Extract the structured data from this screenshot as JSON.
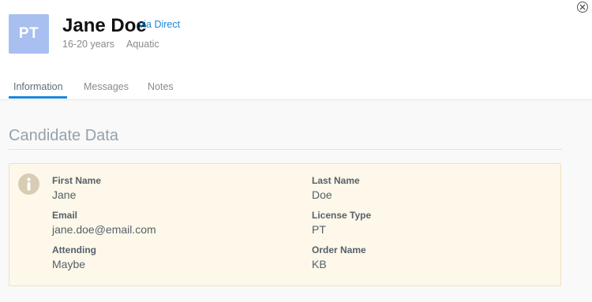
{
  "header": {
    "avatar_initials": "PT",
    "name": "Jane Doe",
    "via": "via Direct",
    "age_range": "16-20 years",
    "category": "Aquatic"
  },
  "tabs": [
    {
      "label": "Information",
      "active": true
    },
    {
      "label": "Messages",
      "active": false
    },
    {
      "label": "Notes",
      "active": false
    }
  ],
  "section": {
    "title": "Candidate Data",
    "fields": [
      {
        "label": "First Name",
        "value": "Jane"
      },
      {
        "label": "Last Name",
        "value": "Doe"
      },
      {
        "label": "Email",
        "value": "jane.doe@email.com"
      },
      {
        "label": "License Type",
        "value": "PT"
      },
      {
        "label": "Attending",
        "value": "Maybe"
      },
      {
        "label": "Order Name",
        "value": "KB"
      }
    ]
  },
  "icons": {
    "close": "close-circle-icon",
    "info": "info-icon"
  },
  "colors": {
    "accent": "#1f86d6",
    "avatar_bg": "#a8bff0",
    "panel_bg": "#fdf8e9"
  }
}
